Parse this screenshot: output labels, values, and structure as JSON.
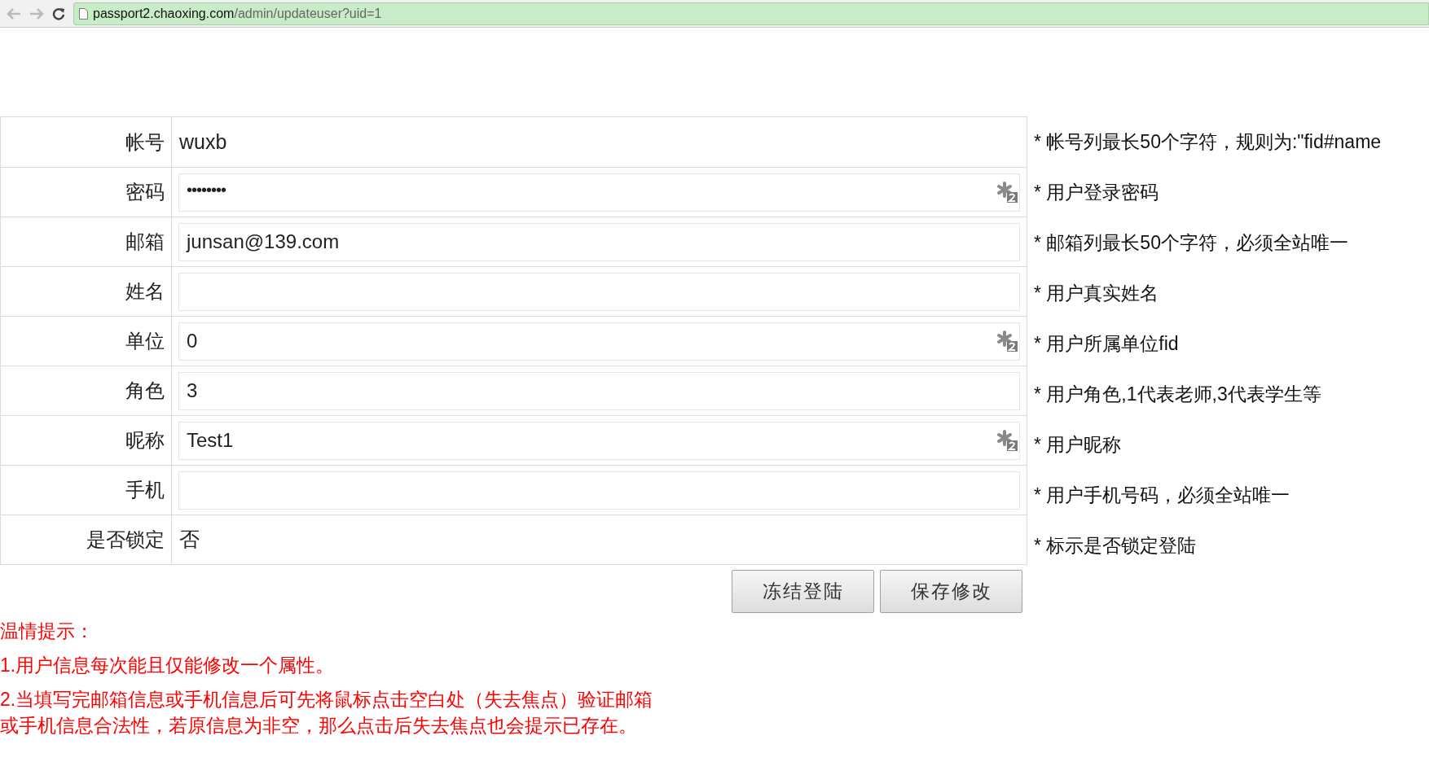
{
  "browser": {
    "url_host": "passport2.chaoxing.com",
    "url_path": "/admin/updateuser?uid=1"
  },
  "rows": [
    {
      "label": "帐号",
      "kind": "text",
      "value": "wuxb",
      "note": "* 帐号列最长50个字符，规则为:\"fid#name"
    },
    {
      "label": "密码",
      "kind": "password",
      "value": "••••••••",
      "badge": true,
      "note": "* 用户登录密码"
    },
    {
      "label": "邮箱",
      "kind": "input",
      "value": "junsan@139.com",
      "badge": false,
      "note": "* 邮箱列最长50个字符，必须全站唯一"
    },
    {
      "label": "姓名",
      "kind": "input",
      "value": "",
      "badge": false,
      "note": "* 用户真实姓名"
    },
    {
      "label": "单位",
      "kind": "input",
      "value": "0",
      "badge": true,
      "note": "* 用户所属单位fid"
    },
    {
      "label": "角色",
      "kind": "input",
      "value": "3",
      "badge": false,
      "note": "* 用户角色,1代表老师,3代表学生等"
    },
    {
      "label": "昵称",
      "kind": "input",
      "value": "Test1",
      "badge": true,
      "note": "* 用户昵称"
    },
    {
      "label": "手机",
      "kind": "input",
      "value": "",
      "badge": false,
      "note": "* 用户手机号码，必须全站唯一"
    },
    {
      "label": "是否锁定",
      "kind": "text",
      "value": "否",
      "note": "* 标示是否锁定登陆"
    }
  ],
  "buttons": [
    "冻结登陆",
    "保存修改"
  ],
  "tips": {
    "title": "温情提示：",
    "items": [
      "1.用户信息每次能且仅能修改一个属性。",
      "2.当填写完邮箱信息或手机信息后可先将鼠标点击空白处（失去焦点）验证邮箱或手机信息合法性，若原信息为非空，那么点击后失去焦点也会提示已存在。"
    ]
  }
}
